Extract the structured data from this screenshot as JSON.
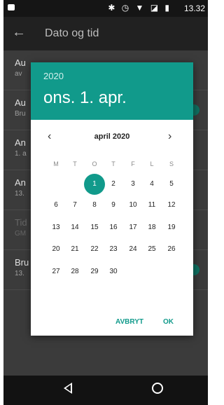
{
  "statusbar": {
    "icons": "✱ ◷ ▼ ◪ ▮",
    "time": "13.32"
  },
  "appbar": {
    "back_icon": "←",
    "title": "Dato og tid"
  },
  "settings": [
    {
      "title": "Au",
      "subtitle": "av",
      "toggle": false,
      "dim": false
    },
    {
      "title": "Au",
      "subtitle": "Bru",
      "toggle": true,
      "dim": false
    },
    {
      "title": "An",
      "subtitle": "1. a",
      "toggle": false,
      "dim": false
    },
    {
      "title": "An",
      "subtitle": "13.",
      "toggle": false,
      "dim": false
    },
    {
      "title": "Tid",
      "subtitle": "GM",
      "toggle": false,
      "dim": true
    },
    {
      "title": "Bru",
      "subtitle": "13.",
      "toggle": true,
      "dim": false
    }
  ],
  "dialog": {
    "year": "2020",
    "date": "ons. 1. apr.",
    "month": "april 2020",
    "prev_icon": "‹",
    "next_icon": "›",
    "weekdays": [
      "M",
      "T",
      "O",
      "T",
      "F",
      "L",
      "S"
    ],
    "weeks": [
      [
        "",
        "",
        "1",
        "2",
        "3",
        "4",
        "5"
      ],
      [
        "6",
        "7",
        "8",
        "9",
        "10",
        "11",
        "12"
      ],
      [
        "13",
        "14",
        "15",
        "16",
        "17",
        "18",
        "19"
      ],
      [
        "20",
        "21",
        "22",
        "23",
        "24",
        "25",
        "26"
      ],
      [
        "27",
        "28",
        "29",
        "30",
        "",
        "",
        ""
      ]
    ],
    "selected_day": "1",
    "cancel_label": "AVBRYT",
    "ok_label": "OK",
    "accent": "#119a8b"
  },
  "navbar": {
    "back_icon": "◁",
    "home_icon": "○"
  }
}
